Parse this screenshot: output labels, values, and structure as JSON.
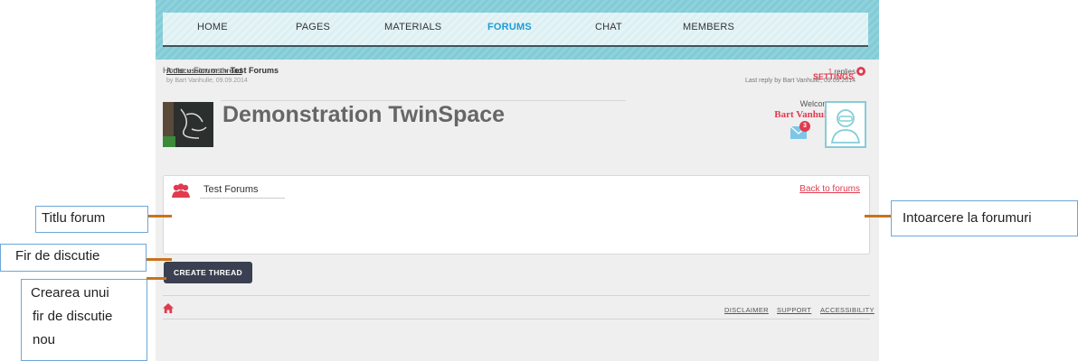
{
  "nav": {
    "items": [
      {
        "label": "HOME"
      },
      {
        "label": "PAGES"
      },
      {
        "label": "MATERIALS"
      },
      {
        "label": "FORUMS"
      },
      {
        "label": "CHAT"
      },
      {
        "label": "MEMBERS"
      }
    ],
    "active": "FORUMS"
  },
  "breadcrumb": {
    "home": "Home",
    "sep": "»",
    "forums": "Forums",
    "current": "Test Forums"
  },
  "settings_label": "SETTINGS",
  "space": {
    "title": "Demonstration TwinSpace"
  },
  "user": {
    "welcome": "Welcome",
    "name": "Bart Vanhulle",
    "unread_count": "3"
  },
  "forum": {
    "title": "Test Forums",
    "back_link": "Back to forums"
  },
  "thread": {
    "title": "A discussion or thread",
    "byline": "by Bart Vanhulle, 09.09.2014",
    "replies_count": "1",
    "replies_label": "replies",
    "last_reply": "Last reply by Bart Vanhulle, 09.09.2014"
  },
  "create_thread_label": "CREATE THREAD",
  "footer": {
    "links": [
      {
        "label": "DISCLAIMER"
      },
      {
        "label": "SUPPORT"
      },
      {
        "label": "ACCESSIBILITY"
      }
    ]
  },
  "annotations": {
    "forum_title": "Titlu forum",
    "thread": "Fir de discutie",
    "create": [
      "Crearea unui",
      "fir de discutie",
      "nou"
    ],
    "back": "Intoarcere la forumuri"
  },
  "colors": {
    "accent": "#e23a4e",
    "nav_active": "#1e9bd6",
    "nav_band": "#82cbd6",
    "button": "#3a3f51",
    "connector": "#c8731c",
    "callout_border": "#6da7d8"
  }
}
